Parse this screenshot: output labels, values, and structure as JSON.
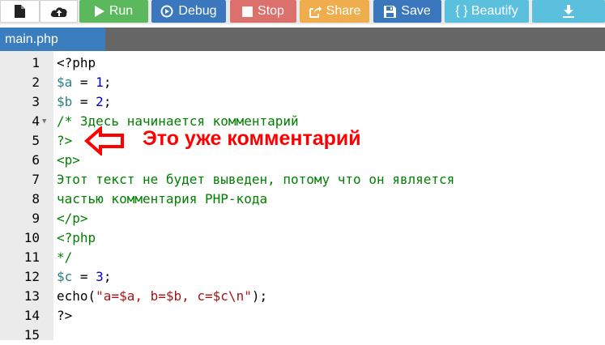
{
  "toolbar": {
    "run_label": "Run",
    "debug_label": "Debug",
    "stop_label": "Stop",
    "share_label": "Share",
    "save_label": "Save",
    "beautify_label": "{ } Beautify"
  },
  "tab": {
    "label": "main.php"
  },
  "lines": [
    {
      "num": "1",
      "t": "<?php"
    },
    {
      "num": "2",
      "a": "$a",
      "b": " = ",
      "c": "1",
      "d": ";"
    },
    {
      "num": "3",
      "a": "$b",
      "b": " = ",
      "c": "2",
      "d": ";"
    },
    {
      "num": "4",
      "t": "/* Здесь начинается комментарий"
    },
    {
      "num": "5",
      "t": "?>"
    },
    {
      "num": "6",
      "t": "<p>"
    },
    {
      "num": "7",
      "t": "Этот текст не будет выведен, потому что он является"
    },
    {
      "num": "8",
      "t": "частью комментария PHP-кода"
    },
    {
      "num": "9",
      "t": "</p>"
    },
    {
      "num": "10",
      "t": "<?php"
    },
    {
      "num": "11",
      "t": "*/"
    },
    {
      "num": "12",
      "a": "$c",
      "b": " = ",
      "c": "3",
      "d": ";"
    },
    {
      "num": "13",
      "a": "echo(",
      "b": "\"a=$a, b=$b, c=$c\\n\"",
      "c": ");"
    },
    {
      "num": "14",
      "t": "?>"
    },
    {
      "num": "15",
      "t": ""
    }
  ],
  "annotation": {
    "text": "Это уже комментарий",
    "color": "#ff0000"
  }
}
